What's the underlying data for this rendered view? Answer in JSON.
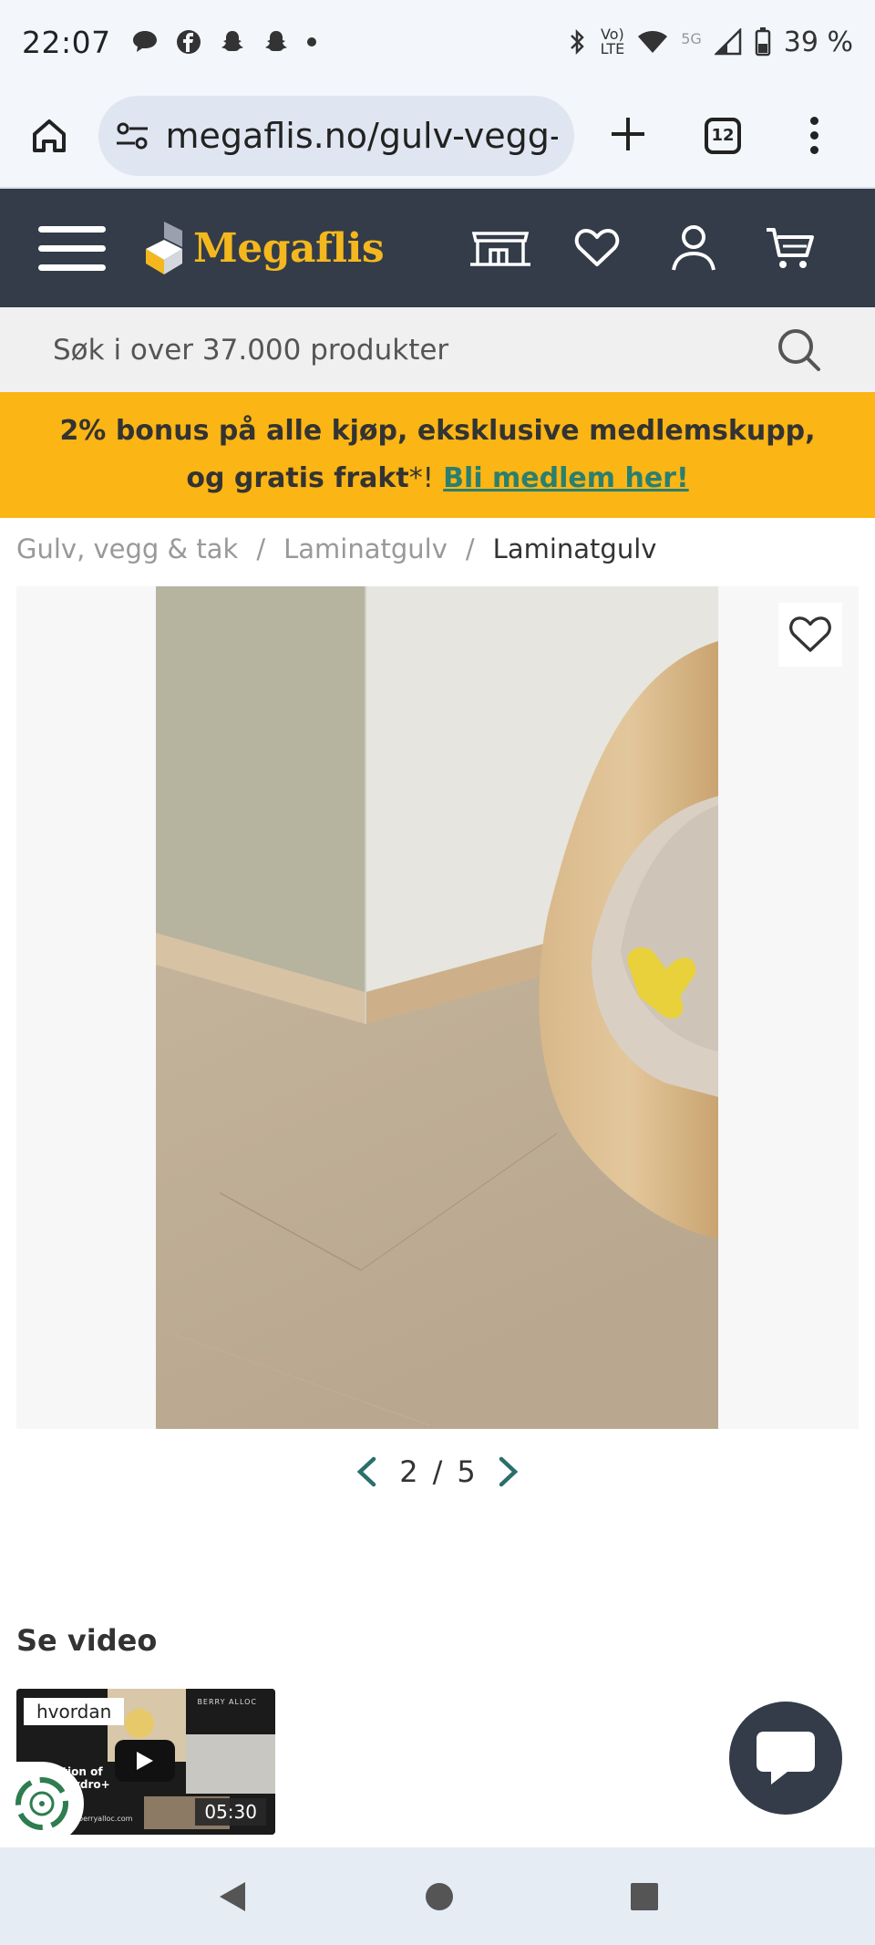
{
  "status_bar": {
    "time": "22:07",
    "notifications": [
      "chat-bubble-icon",
      "facebook-icon",
      "snapchat-icon",
      "snapchat-icon",
      "dot-icon"
    ],
    "network_label_top": "Vo)",
    "network_label_bottom": "LTE",
    "network_5g": "5G",
    "battery": "39 %"
  },
  "browser": {
    "url": "megaflis.no/gulv-vegg-",
    "tab_count": "12"
  },
  "header": {
    "logo_text": "Megaflis",
    "brand_color": "#f4b81e",
    "header_bg": "#333c48"
  },
  "search": {
    "placeholder": "Søk i over 37.000 produkter"
  },
  "promo": {
    "line1": "2% bonus på alle kjøp, eksklusive medlemskupp,",
    "line2_prefix": "og gratis frakt",
    "line2_star": "*!",
    "link": "Bli medlem her!"
  },
  "breadcrumb": {
    "items": [
      "Gulv, vegg & tak",
      "Laminatgulv"
    ],
    "current": "Laminatgulv",
    "separator": "/"
  },
  "gallery": {
    "current": "2",
    "separator": "/",
    "total": "5"
  },
  "video": {
    "title": "Se video",
    "tag": "hvordan",
    "duration": "05:30",
    "overlay_line1": "llation of",
    "overlay_line2": "oc hydro+",
    "overlay_line3": "te",
    "overlay_site": "berryalloc.com",
    "overlay_brand": "BERRY ALLOC"
  }
}
